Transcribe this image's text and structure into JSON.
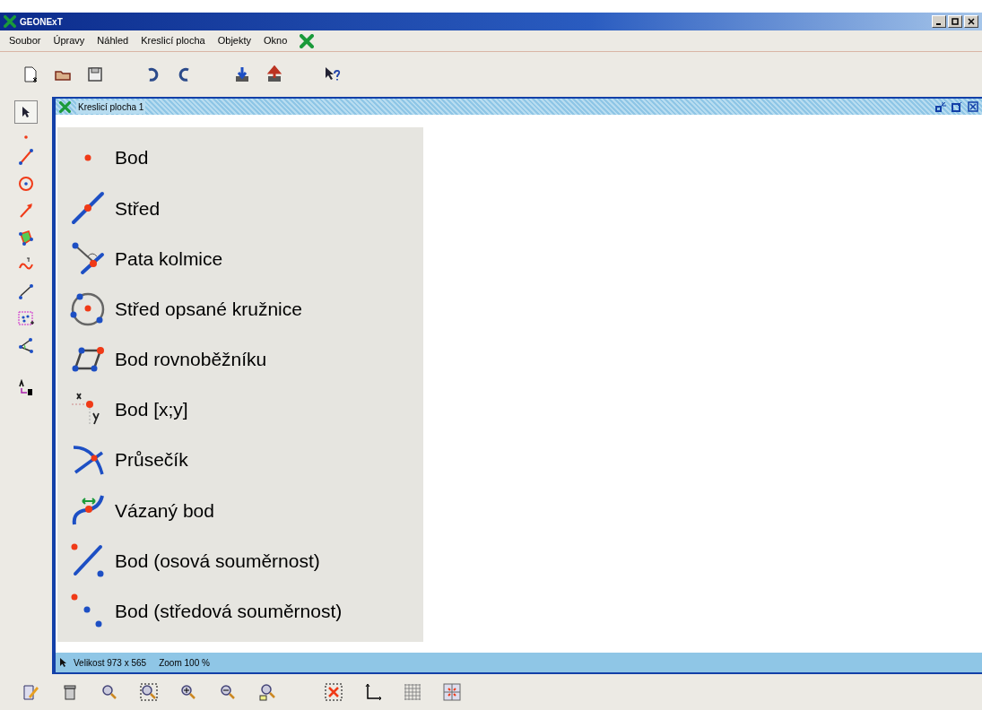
{
  "window": {
    "title": "GEONExT"
  },
  "menu_bar": [
    "Soubor",
    "Úpravy",
    "Náhled",
    "Kreslicí plocha",
    "Objekty",
    "Okno"
  ],
  "document": {
    "title": "Kreslicí plocha 1"
  },
  "point_menu": [
    {
      "label": "Bod"
    },
    {
      "label": "Střed"
    },
    {
      "label": "Pata kolmice"
    },
    {
      "label": "Střed opsané kružnice"
    },
    {
      "label": "Bod rovnoběžníku"
    },
    {
      "label": "Bod [x;y]"
    },
    {
      "label": "Průsečík"
    },
    {
      "label": "Vázaný bod"
    },
    {
      "label": "Bod (osová souměrnost)"
    },
    {
      "label": "Bod (středová souměrnost)"
    }
  ],
  "status_bar": {
    "size": "Velikost 973 x 565",
    "zoom": "Zoom 100 %"
  }
}
